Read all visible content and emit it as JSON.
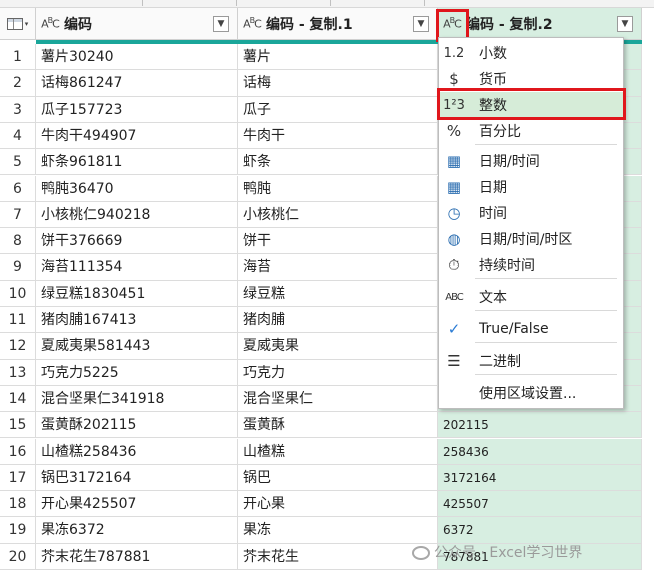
{
  "columns": {
    "col1": {
      "type_icon": "ABC-text-type-icon",
      "name": "编码"
    },
    "col2": {
      "type_icon": "ABC-text-type-icon",
      "name": "编码 - 复制.1"
    },
    "col3": {
      "type_icon": "ABC-text-type-icon",
      "name": "编码 - 复制.2"
    },
    "dropdown_glyph": "▼",
    "corner_glyph": "▾"
  },
  "rows": [
    {
      "n": "1",
      "c1": "薯片30240",
      "c2": "薯片",
      "c3": ""
    },
    {
      "n": "2",
      "c1": "话梅861247",
      "c2": "话梅",
      "c3": ""
    },
    {
      "n": "3",
      "c1": "瓜子157723",
      "c2": "瓜子",
      "c3": ""
    },
    {
      "n": "4",
      "c1": "牛肉干494907",
      "c2": "牛肉干",
      "c3": ""
    },
    {
      "n": "5",
      "c1": "虾条961811",
      "c2": "虾条",
      "c3": ""
    },
    {
      "n": "6",
      "c1": "鸭肫36470",
      "c2": "鸭肫",
      "c3": ""
    },
    {
      "n": "7",
      "c1": "小核桃仁940218",
      "c2": "小核桃仁",
      "c3": ""
    },
    {
      "n": "8",
      "c1": "饼干376669",
      "c2": "饼干",
      "c3": ""
    },
    {
      "n": "9",
      "c1": "海苔111354",
      "c2": "海苔",
      "c3": ""
    },
    {
      "n": "10",
      "c1": "绿豆糕1830451",
      "c2": "绿豆糕",
      "c3": ""
    },
    {
      "n": "11",
      "c1": "猪肉脯167413",
      "c2": "猪肉脯",
      "c3": ""
    },
    {
      "n": "12",
      "c1": "夏威夷果581443",
      "c2": "夏威夷果",
      "c3": ""
    },
    {
      "n": "13",
      "c1": "巧克力5225",
      "c2": "巧克力",
      "c3": ""
    },
    {
      "n": "14",
      "c1": "混合坚果仁341918",
      "c2": "混合坚果仁",
      "c3": ""
    },
    {
      "n": "15",
      "c1": "蛋黄酥202115",
      "c2": "蛋黄酥",
      "c3": "202115"
    },
    {
      "n": "16",
      "c1": "山楂糕258436",
      "c2": "山楂糕",
      "c3": "258436"
    },
    {
      "n": "17",
      "c1": "锅巴3172164",
      "c2": "锅巴",
      "c3": "3172164"
    },
    {
      "n": "18",
      "c1": "开心果425507",
      "c2": "开心果",
      "c3": "425507"
    },
    {
      "n": "19",
      "c1": "果冻6372",
      "c2": "果冻",
      "c3": "6372"
    },
    {
      "n": "20",
      "c1": "芥末花生787881",
      "c2": "芥末花生",
      "c3": "787881"
    }
  ],
  "menu": {
    "items": [
      {
        "icon": "decimal-icon",
        "glyph": "1.2",
        "label": "小数"
      },
      {
        "icon": "currency-icon",
        "glyph": "$",
        "label": "货币"
      },
      {
        "icon": "whole-number-icon",
        "glyph": "1²3",
        "label": "整数",
        "selected": true
      },
      {
        "icon": "percent-icon",
        "glyph": "%",
        "label": "百分比"
      },
      {
        "icon": "datetime-icon",
        "glyph": "▦",
        "label": "日期/时间"
      },
      {
        "icon": "date-icon",
        "glyph": "▦",
        "label": "日期"
      },
      {
        "icon": "time-icon",
        "glyph": "◷",
        "label": "时间"
      },
      {
        "icon": "datetime-zone-icon",
        "glyph": "◍",
        "label": "日期/时间/时区"
      },
      {
        "icon": "duration-icon",
        "glyph": "⏱",
        "label": "持续时间"
      },
      {
        "icon": "text-icon",
        "glyph": "ABC",
        "label": "文本"
      },
      {
        "icon": "true-false-icon",
        "glyph": "✓",
        "label": "True/False"
      },
      {
        "icon": "binary-icon",
        "glyph": "☰",
        "label": "二进制"
      },
      {
        "icon": "",
        "glyph": "",
        "label": "使用区域设置..."
      }
    ]
  },
  "colors": {
    "selected_column": "#d7eee1",
    "accent_underline": "#1aa69a",
    "highlight_box": "#e0161c",
    "menu_selected": "#d6ecd8"
  },
  "watermark": {
    "text": "公众号 · Excel学习世界"
  }
}
